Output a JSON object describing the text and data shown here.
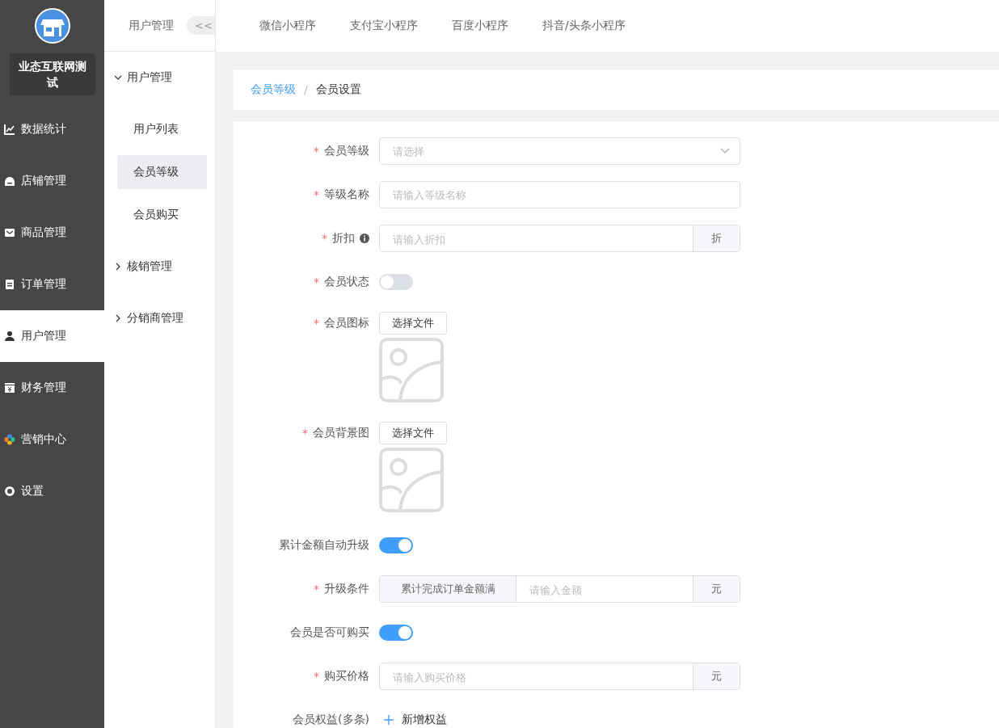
{
  "brand": {
    "name": "业态互联网测试"
  },
  "sidebar": {
    "items": [
      {
        "label": "数据统计",
        "selected": false
      },
      {
        "label": "店铺管理",
        "selected": false
      },
      {
        "label": "商品管理",
        "selected": false
      },
      {
        "label": "订单管理",
        "selected": false
      },
      {
        "label": "用户管理",
        "selected": true
      },
      {
        "label": "财务管理",
        "selected": false
      },
      {
        "label": "营销中心",
        "selected": false
      },
      {
        "label": "设置",
        "selected": false
      }
    ]
  },
  "submenu": {
    "title": "用户管理",
    "collapse_button": "<<",
    "groups": [
      {
        "label": "用户管理",
        "expanded": true,
        "children": [
          {
            "label": "用户列表",
            "selected": false
          },
          {
            "label": "会员等级",
            "selected": true
          },
          {
            "label": "会员购买",
            "selected": false
          }
        ]
      },
      {
        "label": "核销管理",
        "expanded": false
      },
      {
        "label": "分销商管理",
        "expanded": false
      }
    ]
  },
  "top_tabs": [
    "微信小程序",
    "支付宝小程序",
    "百度小程序",
    "抖音/头条小程序"
  ],
  "breadcrumb": [
    {
      "label": "会员等级",
      "kind": "link"
    },
    {
      "label": "会员设置",
      "kind": "current"
    }
  ],
  "breadcrumb_separator": "/",
  "form": [
    {
      "kind": "select",
      "mark": "*",
      "label": "会员等级",
      "placeholder": "请选择"
    },
    {
      "kind": "input",
      "mark": "*",
      "label": "等级名称",
      "placeholder": "请输入等级名称"
    },
    {
      "kind": "input",
      "mark": "*",
      "label": "折扣",
      "info": true,
      "placeholder": "请输入折扣",
      "append": "折"
    },
    {
      "kind": "switch",
      "mark": "*",
      "label": "会员状态",
      "on": false
    },
    {
      "kind": "upload",
      "mark": "*",
      "label": "会员图标",
      "button": "选择文件"
    },
    {
      "kind": "upload",
      "mark": "*",
      "label": "会员背景图",
      "button": "选择文件"
    },
    {
      "kind": "switch",
      "label": "累计金额自动升级",
      "on": true
    },
    {
      "kind": "input",
      "mark": "*",
      "label": "升级条件",
      "prepend": "累计完成订单金额满",
      "placeholder": "请输入金额",
      "append": "元"
    },
    {
      "kind": "switch",
      "label": "会员是否可购买",
      "on": true
    },
    {
      "kind": "input",
      "mark": "*",
      "label": "购买价格",
      "placeholder": "请输入购买价格",
      "append": "元"
    },
    {
      "kind": "add",
      "label": "会员权益(多条)",
      "button": "新增权益"
    }
  ]
}
